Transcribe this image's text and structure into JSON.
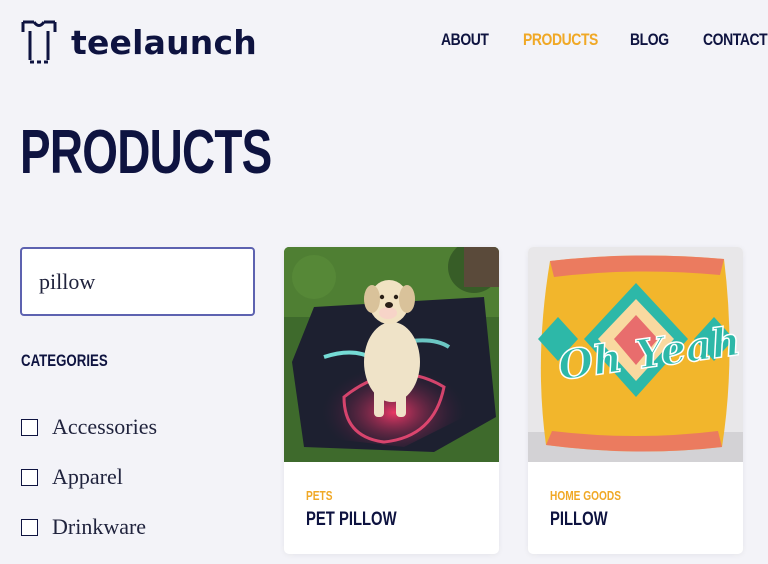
{
  "brand": {
    "name": "teelaunch",
    "logo_icon": "shirt-bracket-icon"
  },
  "nav": {
    "items": [
      {
        "label": "ABOUT",
        "active": false
      },
      {
        "label": "PRODUCTS",
        "active": true
      },
      {
        "label": "BLOG",
        "active": false
      },
      {
        "label": "CONTACT",
        "active": false
      }
    ]
  },
  "page": {
    "title": "PRODUCTS"
  },
  "search": {
    "value": "pillow"
  },
  "categories": {
    "heading": "CATEGORIES",
    "items": [
      {
        "label": "Accessories",
        "checked": false
      },
      {
        "label": "Apparel",
        "checked": false
      },
      {
        "label": "Drinkware",
        "checked": false
      }
    ]
  },
  "products": [
    {
      "category": "PETS",
      "name": "PET PILLOW",
      "image": "dog-on-neon-pillow"
    },
    {
      "category": "HOME GOODS",
      "name": "PILLOW",
      "image": "oh-yeah-aztec-pillow"
    }
  ],
  "colors": {
    "accent": "#f0a826",
    "navy": "#0e1340",
    "background": "#f3f3f8",
    "search_border": "#5d62b0"
  }
}
